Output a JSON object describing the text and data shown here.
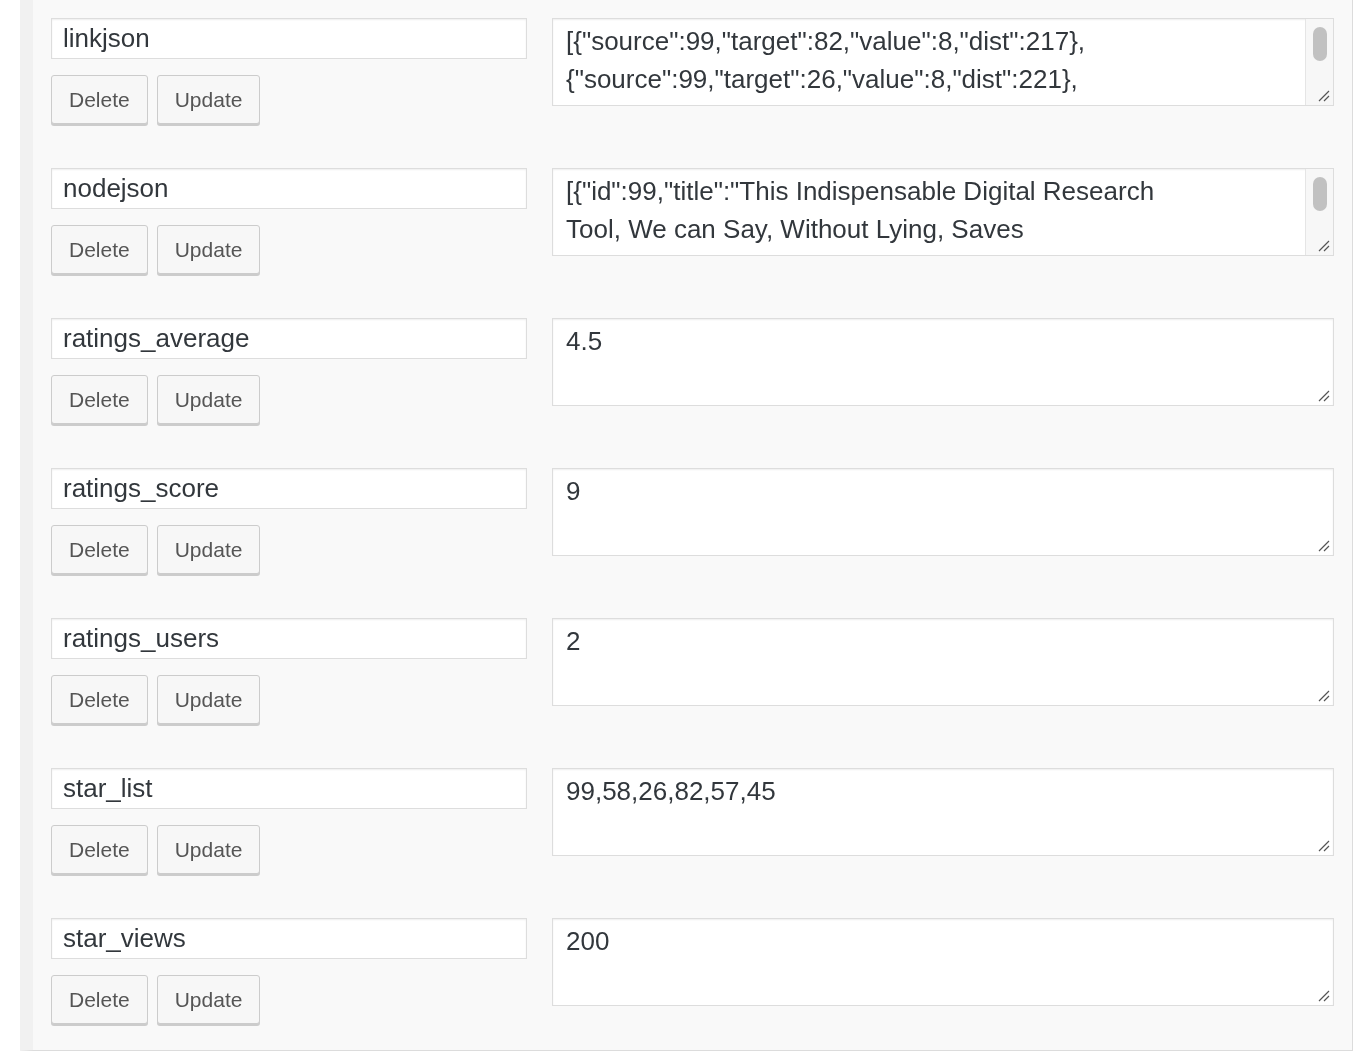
{
  "fields": [
    {
      "key": "linkjson",
      "value": "[{\"source\":99,\"target\":82,\"value\":8,\"dist\":217},\n{\"source\":99,\"target\":26,\"value\":8,\"dist\":221},",
      "scrollable": true,
      "buttons": [
        "Delete",
        "Update"
      ]
    },
    {
      "key": "nodejson",
      "value": "[{\"id\":99,\"title\":\"This Indispensable Digital Research\nTool, We can Say, Without Lying, Saves",
      "scrollable": true,
      "buttons": [
        "Delete",
        "Update"
      ]
    },
    {
      "key": "ratings_average",
      "value": "4.5",
      "scrollable": false,
      "buttons": [
        "Delete",
        "Update"
      ]
    },
    {
      "key": "ratings_score",
      "value": "9",
      "scrollable": false,
      "buttons": [
        "Delete",
        "Update"
      ]
    },
    {
      "key": "ratings_users",
      "value": "2",
      "scrollable": false,
      "buttons": [
        "Delete",
        "Update"
      ]
    },
    {
      "key": "star_list",
      "value": "99,58,26,82,57,45",
      "scrollable": false,
      "buttons": [
        "Delete",
        "Update"
      ]
    },
    {
      "key": "star_views",
      "value": "200",
      "scrollable": false,
      "buttons": [
        "Delete",
        "Update"
      ]
    }
  ]
}
